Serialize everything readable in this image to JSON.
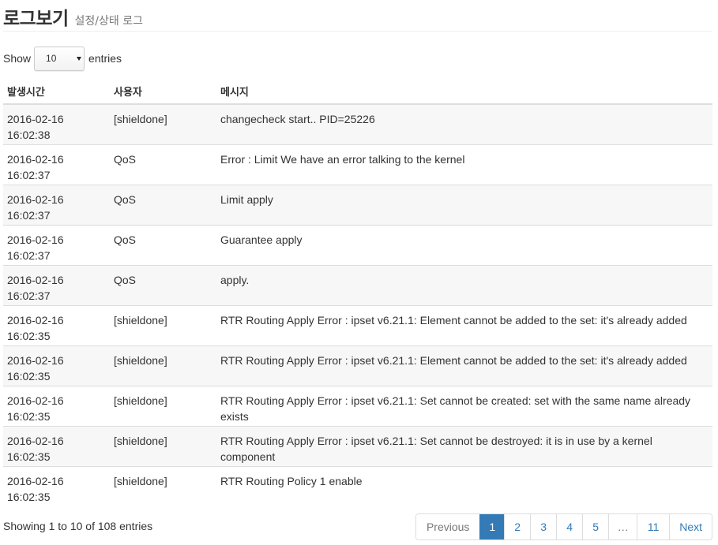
{
  "header": {
    "title": "로그보기",
    "subtitle": "설정/상태 로그"
  },
  "length": {
    "prefix": "Show",
    "value": "10",
    "suffix": "entries"
  },
  "table": {
    "columns": [
      "발생시간",
      "사용자",
      "메시지"
    ],
    "rows": [
      {
        "date": "2016-02-16",
        "time": "16:02:38",
        "user": "[shieldone]",
        "message": "changecheck start.. PID=25226"
      },
      {
        "date": "2016-02-16",
        "time": "16:02:37",
        "user": "QoS",
        "message": "Error : Limit We have an error talking to the kernel"
      },
      {
        "date": "2016-02-16",
        "time": "16:02:37",
        "user": "QoS",
        "message": "Limit apply"
      },
      {
        "date": "2016-02-16",
        "time": "16:02:37",
        "user": "QoS",
        "message": "Guarantee apply"
      },
      {
        "date": "2016-02-16",
        "time": "16:02:37",
        "user": "QoS",
        "message": "apply."
      },
      {
        "date": "2016-02-16",
        "time": "16:02:35",
        "user": "[shieldone]",
        "message": "RTR Routing Apply Error : ipset v6.21.1: Element cannot be added to the set: it's already added"
      },
      {
        "date": "2016-02-16",
        "time": "16:02:35",
        "user": "[shieldone]",
        "message": "RTR Routing Apply Error : ipset v6.21.1: Element cannot be added to the set: it's already added"
      },
      {
        "date": "2016-02-16",
        "time": "16:02:35",
        "user": "[shieldone]",
        "message": "RTR Routing Apply Error : ipset v6.21.1: Set cannot be created: set with the same name already exists"
      },
      {
        "date": "2016-02-16",
        "time": "16:02:35",
        "user": "[shieldone]",
        "message": "RTR Routing Apply Error : ipset v6.21.1: Set cannot be destroyed: it is in use by a kernel component"
      },
      {
        "date": "2016-02-16",
        "time": "16:02:35",
        "user": "[shieldone]",
        "message": "RTR Routing Policy 1 enable"
      }
    ]
  },
  "info": "Showing 1 to 10 of 108 entries",
  "pagination": {
    "previous": "Previous",
    "pages": [
      "1",
      "2",
      "3",
      "4",
      "5",
      "…",
      "11"
    ],
    "active": "1",
    "next": "Next"
  },
  "colors": {
    "accent": "#337ab7",
    "stripe": "#f7f7f7",
    "border": "#dddddd"
  }
}
